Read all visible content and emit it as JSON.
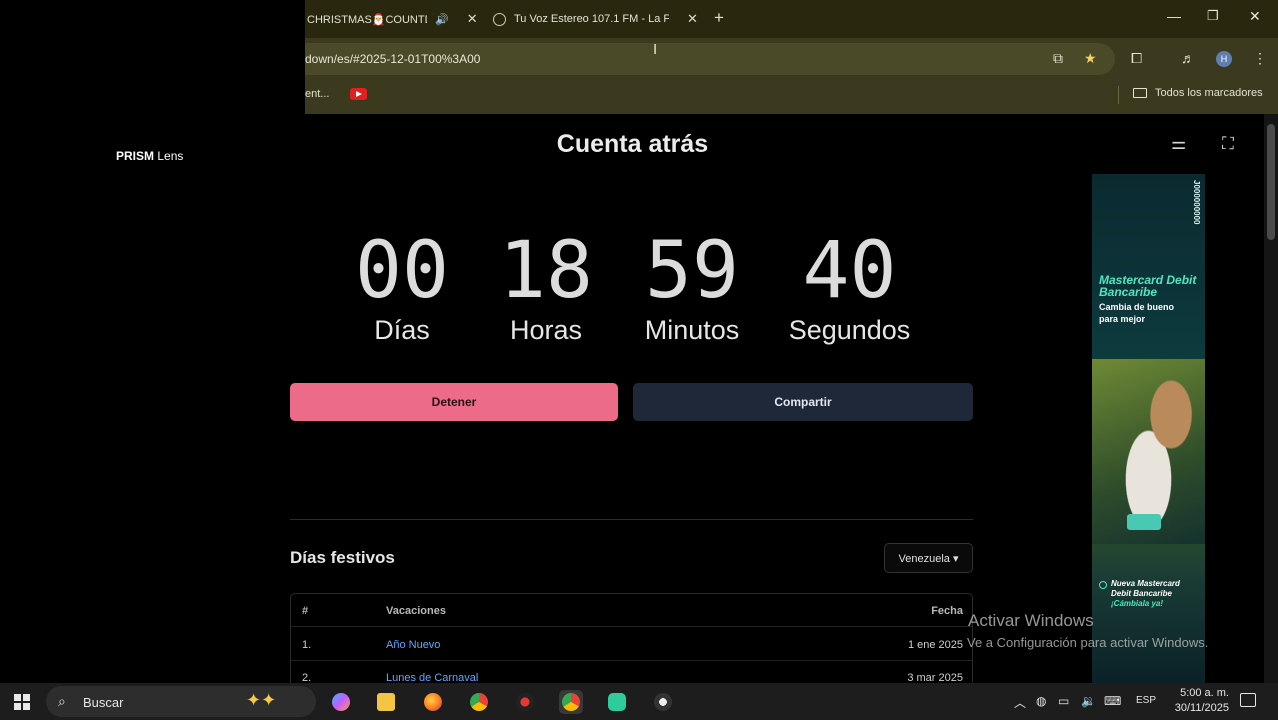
{
  "overlay": {
    "brand_bold": "PRISM",
    "brand_rest": " Lens"
  },
  "browser": {
    "tabs": [
      {
        "title": "CHRISTMAS🎅COUNTD",
        "audio": true
      },
      {
        "title": "Tu Voz Estereo 107.1 FM - La F"
      }
    ],
    "url": "down/es/#2025-12-01T00%3A00",
    "bookmarks": [
      {
        "label": "ent..."
      }
    ],
    "all_bookmarks_label": "Todos los marcadores",
    "profile_initial": "H"
  },
  "page": {
    "title": "Cuenta atrás",
    "countdown": [
      {
        "value": "00",
        "label": "Días"
      },
      {
        "value": "18",
        "label": "Horas"
      },
      {
        "value": "59",
        "label": "Minutos"
      },
      {
        "value": "40",
        "label": "Segundos"
      }
    ],
    "stop_label": "Detener",
    "share_label": "Compartir",
    "holidays_title": "Días festivos",
    "country": "Venezuela",
    "table": {
      "headers": [
        "#",
        "Vacaciones",
        "Fecha"
      ],
      "rows": [
        [
          "1.",
          "Año Nuevo",
          "1 ene 2025"
        ],
        [
          "2.",
          "Lunes de Carnaval",
          "3 mar 2025"
        ]
      ]
    }
  },
  "ad": {
    "code": "J000000000",
    "title": "Mastercard Debit Bancaribe",
    "subtitle": "Cambia de bueno para mejor",
    "footer": "Nueva Mastercard Debit Bancaribe",
    "cta": "¡Cámbiala ya!"
  },
  "watermark": {
    "line1": "Activar Windows",
    "line2": "Ve a Configuración para activar Windows."
  },
  "taskbar": {
    "search_placeholder": "Buscar",
    "language": "ESP",
    "time": "5:00 a. m.",
    "date": "30/11/2025"
  }
}
